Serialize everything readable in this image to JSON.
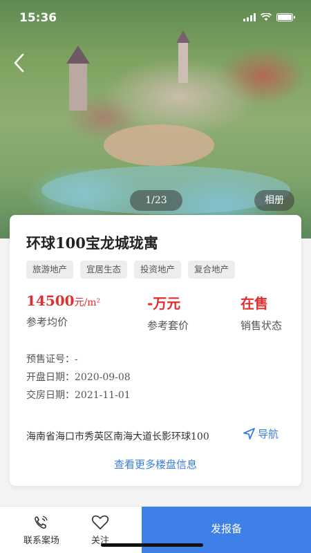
{
  "status_bar": {
    "time": "15:36"
  },
  "gallery": {
    "pager": "1/23",
    "album_label": "相册"
  },
  "property": {
    "title": "环球100宝龙城珑寓",
    "tags": [
      "旅游地产",
      "宜居生态",
      "投资地产",
      "复合地产"
    ],
    "stats": {
      "avg_price_value": "14500",
      "avg_price_unit": "元/m²",
      "avg_price_label": "参考均价",
      "total_price_value": "-万元",
      "total_price_label": "参考套价",
      "sale_status_value": "在售",
      "sale_status_label": "销售状态"
    },
    "presale_label": "预售证号：",
    "presale_value": "-",
    "opening_label": "开盘日期：",
    "opening_value": "2020-09-08",
    "delivery_label": "交房日期：",
    "delivery_value": "2021-11-01",
    "address_prefix": "海南省海口市秀英区南海大道长影环球",
    "address_num": "100",
    "navigate_label": "导航",
    "more_link": "查看更多楼盘信息"
  },
  "bottom_bar": {
    "contact_label": "联系案场",
    "follow_label": "关注",
    "report_label": "发报备"
  },
  "colors": {
    "accent_blue": "#3e7fe8",
    "price_red": "#e02d2d"
  },
  "icons": [
    "back-arrow-icon",
    "location-arrow-icon",
    "phone-icon",
    "heart-icon",
    "signal-icon",
    "wifi-icon",
    "battery-icon"
  ]
}
